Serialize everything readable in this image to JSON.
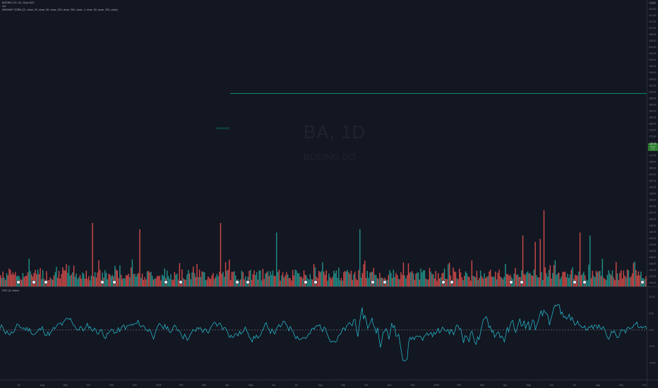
{
  "header": {
    "title": "BOEING CO, 1D, Cboe BZX",
    "volume": "Vol",
    "mavwap": "MAVWAP CDRM (21, close, 20, close, 50, close, 200, close, 300, close, 1, close, 50, close, 200, close)"
  },
  "watermark": {
    "symbol": "BA, 1D",
    "name": "BOEING CO"
  },
  "indicator": {
    "label": "ROC (9, close)"
  },
  "level_line": {
    "label": "6,190.98 (22)",
    "color": "#089981",
    "price": 189.5
  },
  "price_tag": {
    "lines": [
      "187.85",
      "5,4.1",
      "1.2"
    ],
    "price": 187.5
  },
  "currency": "USD",
  "colors": {
    "background": "#131722",
    "up": "#26a69a",
    "down": "#ef5350",
    "level": "#089981",
    "roc": "#26c6da"
  },
  "price_axis": {
    "min": 128,
    "max": 218,
    "ticks": [
      "218.00",
      "216.00",
      "214.00",
      "212.00",
      "210.00",
      "208.00",
      "206.00",
      "204.00",
      "202.00",
      "200.00",
      "198.00",
      "196.00",
      "194.00",
      "192.00",
      "190.00",
      "188.00",
      "186.00",
      "184.00",
      "182.00",
      "180.00",
      "178.00",
      "176.00",
      "174.00",
      "172.00",
      "170.00",
      "168.00",
      "166.00",
      "164.00",
      "162.00",
      "160.00",
      "158.00",
      "156.00",
      "154.00",
      "152.00",
      "150.00",
      "148.00",
      "146.00",
      "144.00",
      "142.00",
      "140.00",
      "138.00",
      "136.00",
      "134.00",
      "132.00",
      "130.00"
    ]
  },
  "roc_axis": {
    "min": -15,
    "max": 13,
    "ticks": [
      "10.00",
      "5.00",
      "0.00",
      "-5.00",
      "-10.00"
    ]
  },
  "time_axis": {
    "labels": [
      "Jul",
      "Aug",
      "Sep",
      "Oct",
      "Nov",
      "Dec",
      "2008",
      "Feb",
      "Mar",
      "Apr",
      "May",
      "Jun",
      "Jul",
      "Aug",
      "Sep",
      "Oct",
      "Nov",
      "Dec",
      "2009",
      "Feb",
      "Mar",
      "Apr",
      "May",
      "Jun",
      "Jul",
      "Aug",
      "Sep",
      "Oct"
    ]
  },
  "chart_data": {
    "type": "bar",
    "bars": 520,
    "volume_seed": 7,
    "roc_seed": 11
  }
}
